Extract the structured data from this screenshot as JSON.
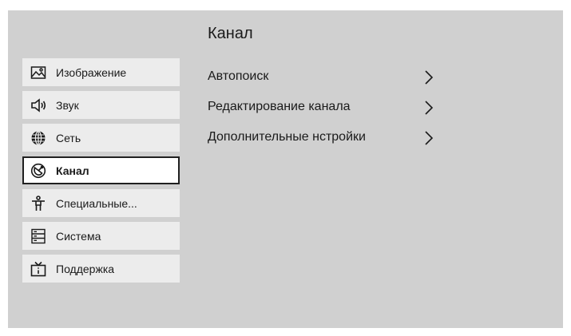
{
  "colors": {
    "screen_bg": "#d0d0d0",
    "item_bg": "#ececec",
    "selected_bg": "#ffffff",
    "text": "#1a1a1a"
  },
  "main": {
    "title": "Канал",
    "items": [
      {
        "label": "Автопоиск",
        "icon": "chevron-right-icon"
      },
      {
        "label": "Редактирование канала",
        "icon": "chevron-right-icon"
      },
      {
        "label": "Дополнительные нстройки",
        "icon": "chevron-right-icon"
      }
    ]
  },
  "sidebar": {
    "selected_index": 3,
    "items": [
      {
        "label": "Изображение",
        "icon": "picture-icon"
      },
      {
        "label": "Звук",
        "icon": "speaker-icon"
      },
      {
        "label": "Сеть",
        "icon": "globe-icon"
      },
      {
        "label": "Канал",
        "icon": "antenna-dish-icon"
      },
      {
        "label": "Специальные...",
        "icon": "accessibility-icon"
      },
      {
        "label": "Система",
        "icon": "system-icon"
      },
      {
        "label": "Поддержка",
        "icon": "tv-info-icon"
      }
    ]
  }
}
